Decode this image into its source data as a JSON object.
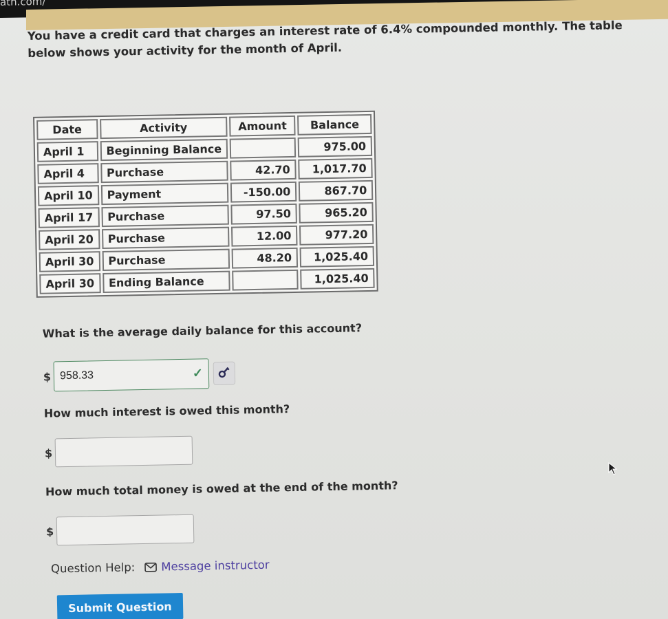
{
  "browser": {
    "url_fragment": "ath.com/"
  },
  "problem": {
    "intro": "You have a credit card that charges an interest rate of 6.4% compounded monthly. The table below shows your activity for the month of April."
  },
  "table": {
    "headers": [
      "Date",
      "Activity",
      "Amount",
      "Balance"
    ],
    "rows": [
      {
        "date": "April 1",
        "activity": "Beginning Balance",
        "amount": "",
        "balance": "975.00"
      },
      {
        "date": "April 4",
        "activity": "Purchase",
        "amount": "42.70",
        "balance": "1,017.70"
      },
      {
        "date": "April 10",
        "activity": "Payment",
        "amount": "-150.00",
        "balance": "867.70"
      },
      {
        "date": "April 17",
        "activity": "Purchase",
        "amount": "97.50",
        "balance": "965.20"
      },
      {
        "date": "April 20",
        "activity": "Purchase",
        "amount": "12.00",
        "balance": "977.20"
      },
      {
        "date": "April 30",
        "activity": "Purchase",
        "amount": "48.20",
        "balance": "1,025.40"
      },
      {
        "date": "April 30",
        "activity": "Ending Balance",
        "amount": "",
        "balance": "1,025.40"
      }
    ]
  },
  "questions": [
    {
      "text": "What is the average daily balance for this account?",
      "currency": "$",
      "value": "958.33",
      "status": "correct",
      "status_icon": "check-icon",
      "extra_icon": "key-icon"
    },
    {
      "text": "How much interest is owed this month?",
      "currency": "$",
      "value": ""
    },
    {
      "text": "How much total money is owed at the end of the month?",
      "currency": "$",
      "value": ""
    }
  ],
  "help": {
    "label": "Question Help:",
    "link_icon": "mail-icon",
    "link_text": "Message instructor"
  },
  "submit": {
    "label": "Submit Question"
  },
  "colors": {
    "submit_bg": "#1e86cf",
    "link": "#4d3fa0",
    "correct": "#3f8a5a",
    "header_accent": "#d9c28a"
  }
}
